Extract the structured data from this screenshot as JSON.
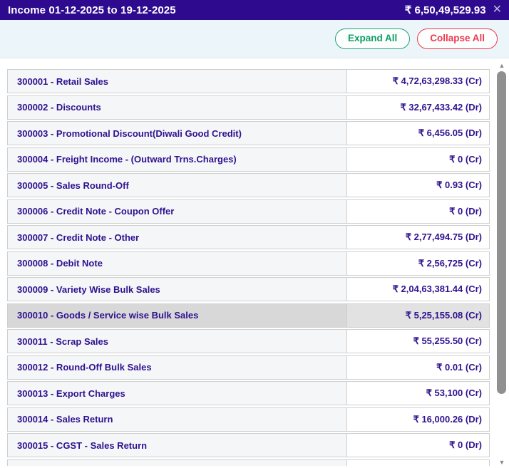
{
  "header": {
    "title": "Income 01-12-2025 to 19-12-2025",
    "total": "₹ 6,50,49,529.93",
    "close_icon": "✕"
  },
  "toolbar": {
    "expand_label": "Expand All",
    "collapse_label": "Collapse All"
  },
  "table": {
    "rows": [
      {
        "account": "300001 - Retail Sales",
        "amount": "₹ 4,72,63,298.33 (Cr)",
        "highlighted": false
      },
      {
        "account": "300002 - Discounts",
        "amount": "₹ 32,67,433.42 (Dr)",
        "highlighted": false
      },
      {
        "account": "300003 - Promotional Discount(Diwali Good Credit)",
        "amount": "₹ 6,456.05 (Dr)",
        "highlighted": false
      },
      {
        "account": "300004 - Freight Income - (Outward Trns.Charges)",
        "amount": "₹ 0 (Cr)",
        "highlighted": false
      },
      {
        "account": "300005 - Sales Round-Off",
        "amount": "₹ 0.93 (Cr)",
        "highlighted": false
      },
      {
        "account": "300006 - Credit Note - Coupon Offer",
        "amount": "₹ 0 (Dr)",
        "highlighted": false
      },
      {
        "account": "300007 - Credit Note - Other",
        "amount": "₹ 2,77,494.75 (Dr)",
        "highlighted": false
      },
      {
        "account": "300008 - Debit Note",
        "amount": "₹ 2,56,725 (Cr)",
        "highlighted": false
      },
      {
        "account": "300009 - Variety Wise Bulk Sales",
        "amount": "₹ 2,04,63,381.44 (Cr)",
        "highlighted": false
      },
      {
        "account": "300010 - Goods / Service wise Bulk Sales",
        "amount": "₹ 5,25,155.08 (Cr)",
        "highlighted": true
      },
      {
        "account": "300011 - Scrap Sales",
        "amount": "₹ 55,255.50 (Cr)",
        "highlighted": false
      },
      {
        "account": "300012 - Round-Off Bulk Sales",
        "amount": "₹ 0.01 (Cr)",
        "highlighted": false
      },
      {
        "account": "300013 - Export Charges",
        "amount": "₹ 53,100 (Cr)",
        "highlighted": false
      },
      {
        "account": "300014 - Sales Return",
        "amount": "₹ 16,000.26 (Dr)",
        "highlighted": false
      },
      {
        "account": "300015 - CGST - Sales Return",
        "amount": "₹ 0 (Dr)",
        "highlighted": false
      }
    ]
  },
  "scrollbar": {
    "up_icon": "▲",
    "down_icon": "▼"
  },
  "colors": {
    "header_bg": "#2e0a8f",
    "row_text": "#2f128f",
    "toolbar_bg": "#ebf5fa",
    "expand_green": "#0e9e66",
    "collapse_red": "#ee3950",
    "row_left_bg": "#f5f6f8",
    "highlight_left_bg": "#d8d8d8",
    "highlight_right_bg": "#e2e2e2",
    "cell_border": "#cfcfcf",
    "scroll_thumb": "#909090"
  }
}
